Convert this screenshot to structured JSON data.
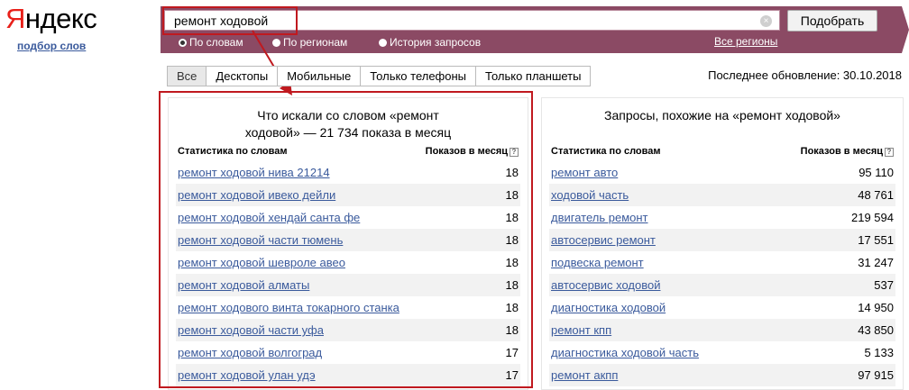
{
  "logo": {
    "first": "Я",
    "rest": "ндекс"
  },
  "sublink": "подбор слов",
  "search": {
    "value": "ремонт ходовой",
    "clear": "×",
    "button": "Подобрать"
  },
  "radios": [
    {
      "label": "По словам",
      "selected": true
    },
    {
      "label": "По регионам",
      "selected": false
    },
    {
      "label": "История запросов",
      "selected": false
    }
  ],
  "regions_link": "Все регионы",
  "tabs": [
    "Все",
    "Десктопы",
    "Мобильные",
    "Только телефоны",
    "Только планшеты"
  ],
  "active_tab": "Все",
  "updated": "Последнее обновление: 30.10.2018",
  "left_panel": {
    "title_line1": "Что искали со словом «ремонт",
    "title_line2": "ходовой» — 21 734 показа в месяц",
    "col_keyword": "Статистика по словам",
    "col_count": "Показов в месяц",
    "help": "?",
    "rows": [
      {
        "kw": "ремонт ходовой нива 21214",
        "cnt": "18"
      },
      {
        "kw": "ремонт ходовой ивеко дейли",
        "cnt": "18"
      },
      {
        "kw": "ремонт ходовой хендай санта фе",
        "cnt": "18"
      },
      {
        "kw": "ремонт ходовой части тюмень",
        "cnt": "18"
      },
      {
        "kw": "ремонт ходовой шевроле авео",
        "cnt": "18"
      },
      {
        "kw": "ремонт ходовой алматы",
        "cnt": "18"
      },
      {
        "kw": "ремонт ходового винта токарного станка",
        "cnt": "18"
      },
      {
        "kw": "ремонт ходовой части уфа",
        "cnt": "18"
      },
      {
        "kw": "ремонт ходовой волгоград",
        "cnt": "17"
      },
      {
        "kw": "ремонт ходовой улан удэ",
        "cnt": "17"
      }
    ]
  },
  "right_panel": {
    "title": "Запросы, похожие на «ремонт ходовой»",
    "col_keyword": "Статистика по словам",
    "col_count": "Показов в месяц",
    "help": "?",
    "rows": [
      {
        "kw": "ремонт авто",
        "cnt": "95 110"
      },
      {
        "kw": "ходовой часть",
        "cnt": "48 761"
      },
      {
        "kw": "двигатель ремонт",
        "cnt": "219 594"
      },
      {
        "kw": "автосервис ремонт",
        "cnt": "17 551"
      },
      {
        "kw": "подвеска ремонт",
        "cnt": "31 247"
      },
      {
        "kw": "автосервис ходовой",
        "cnt": "537"
      },
      {
        "kw": "диагностика ходовой",
        "cnt": "14 950"
      },
      {
        "kw": "ремонт кпп",
        "cnt": "43 850"
      },
      {
        "kw": "диагностика ходовой часть",
        "cnt": "5 133"
      },
      {
        "kw": "ремонт акпп",
        "cnt": "97 915"
      }
    ]
  },
  "colors": {
    "brand_red": "#e8201a",
    "bar": "#8b4a64",
    "link": "#3a5a9c",
    "highlight": "#c0191f"
  }
}
